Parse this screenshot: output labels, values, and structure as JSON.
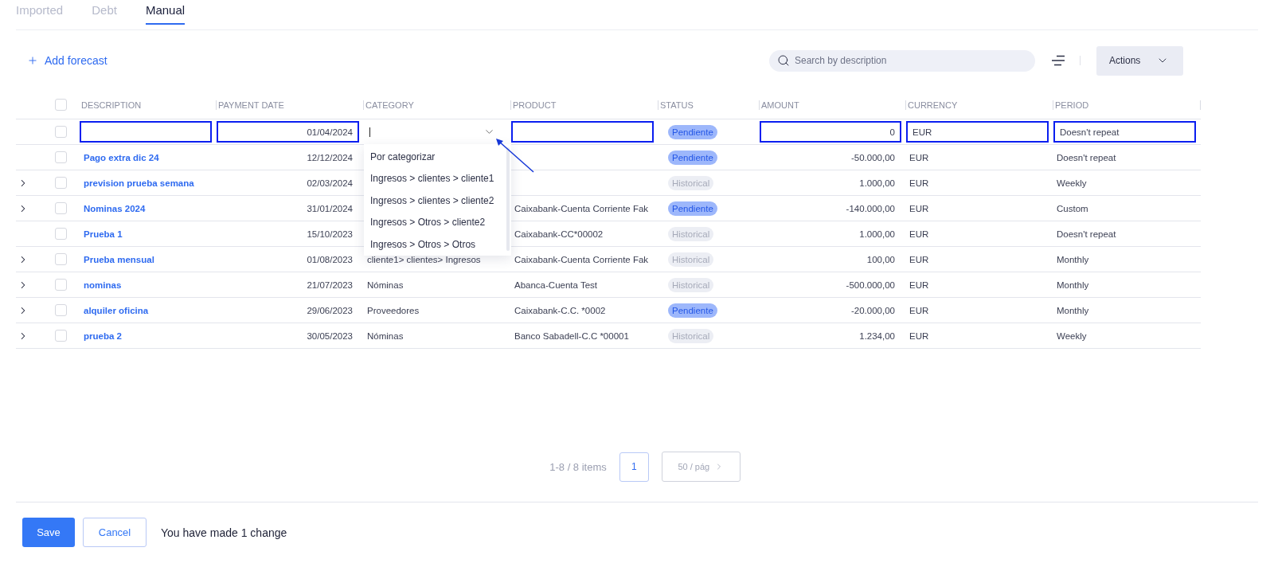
{
  "tabs": [
    {
      "label": "Imported",
      "selected": false
    },
    {
      "label": "Debt",
      "selected": false
    },
    {
      "label": "Manual",
      "selected": true
    }
  ],
  "toolbar": {
    "add_label": "Add forecast",
    "search": {
      "placeholder": "Search by description"
    },
    "actions_label": "Actions"
  },
  "table": {
    "header_checkbox": {
      "checked": false
    },
    "columns": [
      "DESCRIPTION",
      "PAYMENT DATE",
      "CATEGORY",
      "PRODUCT",
      "STATUS",
      "AMOUNT",
      "CURRENCY",
      "PERIOD"
    ],
    "edit_row": {
      "checked": false,
      "payment_date": "01/04/2024",
      "status": {
        "label": "Pendiente",
        "kind": "pending"
      },
      "amount": "0",
      "currency": "EUR",
      "period": "Doesn't repeat",
      "category_options": [
        "Por categorizar",
        "Ingresos > clientes > cliente1",
        "Ingresos > clientes > cliente2",
        "Ingresos > Otros > cliente2",
        "Ingresos > Otros > Otros"
      ]
    },
    "rows": [
      {
        "expandable": false,
        "checked": false,
        "description": "Pago extra dic 24",
        "payment_date": "12/12/2024",
        "status": {
          "label": "Pendiente",
          "kind": "pending"
        },
        "amount": "-50.000,00",
        "currency": "EUR",
        "period": "Doesn't repeat"
      },
      {
        "expandable": true,
        "checked": false,
        "description": "prevision prueba semana",
        "payment_date": "02/03/2024",
        "status": {
          "label": "Historical",
          "kind": "historical"
        },
        "amount": "1.000,00",
        "currency": "EUR",
        "period": "Weekly"
      },
      {
        "expandable": true,
        "checked": false,
        "description": "Nominas 2024",
        "payment_date": "31/01/2024",
        "product": "Caixabank-Cuenta Corriente Fak",
        "status": {
          "label": "Pendiente",
          "kind": "pending"
        },
        "amount": "-140.000,00",
        "currency": "EUR",
        "period": "Custom"
      },
      {
        "expandable": false,
        "checked": false,
        "description": "Prueba 1",
        "payment_date": "15/10/2023",
        "product": "Caixabank-CC*00002",
        "status": {
          "label": "Historical",
          "kind": "historical"
        },
        "amount": "1.000,00",
        "currency": "EUR",
        "period": "Doesn't repeat"
      },
      {
        "expandable": true,
        "checked": false,
        "description": "Prueba mensual",
        "payment_date": "01/08/2023",
        "category": "cliente1> clientes> Ingresos",
        "product": "Caixabank-Cuenta Corriente Fak",
        "status": {
          "label": "Historical",
          "kind": "historical"
        },
        "amount": "100,00",
        "currency": "EUR",
        "period": "Monthly"
      },
      {
        "expandable": true,
        "checked": false,
        "description": "nominas",
        "payment_date": "21/07/2023",
        "category": "Nóminas",
        "product": "Abanca-Cuenta Test",
        "status": {
          "label": "Historical",
          "kind": "historical"
        },
        "amount": "-500.000,00",
        "currency": "EUR",
        "period": "Monthly"
      },
      {
        "expandable": true,
        "checked": false,
        "description": "alquiler oficina",
        "payment_date": "29/06/2023",
        "category": "Proveedores",
        "product": "Caixabank-C.C. *0002",
        "status": {
          "label": "Pendiente",
          "kind": "pending"
        },
        "amount": "-20.000,00",
        "currency": "EUR",
        "period": "Monthly"
      },
      {
        "expandable": true,
        "checked": false,
        "description": "prueba 2",
        "payment_date": "30/05/2023",
        "category": "Nóminas",
        "product": "Banco Sabadell-C.C *00001",
        "status": {
          "label": "Historical",
          "kind": "historical"
        },
        "amount": "1.234,00",
        "currency": "EUR",
        "period": "Weekly"
      }
    ]
  },
  "pagination": {
    "range": "1-8 / 8 items",
    "pages": [
      {
        "label": "1",
        "selected": true
      }
    ],
    "page_size": "50 / pág"
  },
  "footer": {
    "save": "Save",
    "cancel": "Cancel",
    "message": "You have made 1 change"
  }
}
